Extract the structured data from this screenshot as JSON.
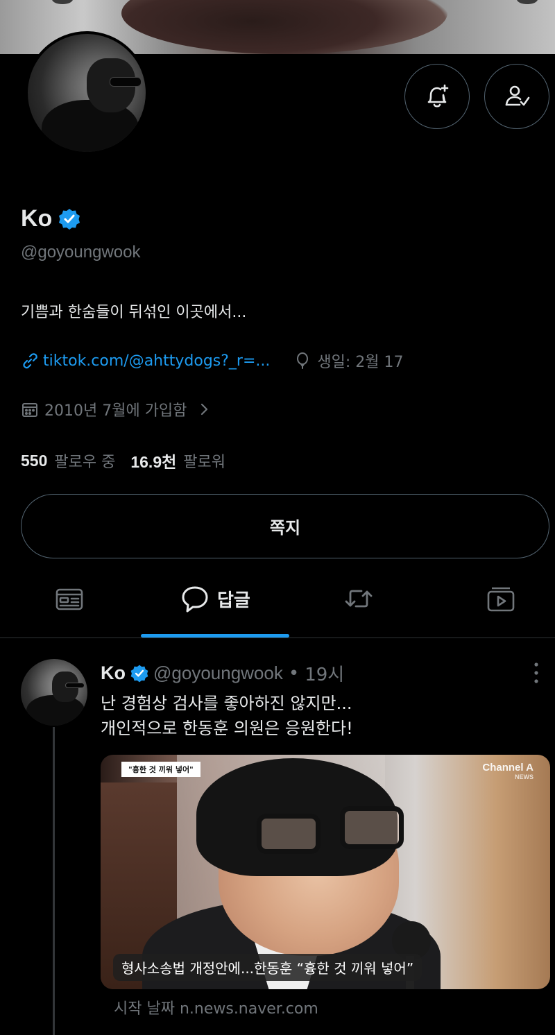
{
  "profile": {
    "name": "Ko",
    "handle": "@goyoungwook",
    "bio": "기쁨과 한숨들이 뒤섞인 이곳에서...",
    "link": "tiktok.com/@ahttydogs?_r=...",
    "birthday": "생일: 2월 17",
    "joined": "2010년 7월에 가입함",
    "following_count": "550",
    "following_label": "팔로우 중",
    "followers_count": "16.9천",
    "followers_label": "팔로워"
  },
  "actions": {
    "message_label": "쪽지"
  },
  "tabs": {
    "replies_label": "답글"
  },
  "tweet": {
    "name": "Ko",
    "handle": "@goyoungwook",
    "separator": "•",
    "time": "19시",
    "text": "난 경험상 검사를 좋아하진 않지만...\n개인적으로 한동훈 의원은 응원한다!",
    "media_tag": "\"흉한 것 끼워 넣어\"",
    "media_logo": "Channel A",
    "media_logo_sub": "NEWS",
    "media_caption": "형사소송법 개정안에...한동훈 “흉한 것 끼워 넣어”",
    "source": "시작 날짜 n.news.naver.com"
  },
  "icons": {
    "notify": "bell-plus-icon",
    "following": "person-check-icon",
    "verified": "verified-badge-icon",
    "link": "link-icon",
    "birthday": "balloon-icon",
    "calendar": "calendar-icon",
    "chevron": "chevron-right-icon",
    "tab_posts": "posts-icon",
    "tab_replies": "reply-bubble-icon",
    "tab_retweets": "retweet-icon",
    "tab_media": "media-icon",
    "more": "more-vertical-icon"
  },
  "colors": {
    "background": "#000000",
    "accent": "#1d9bf0",
    "text": "#e7e9ea",
    "muted": "#71767b",
    "border": "#536471"
  }
}
